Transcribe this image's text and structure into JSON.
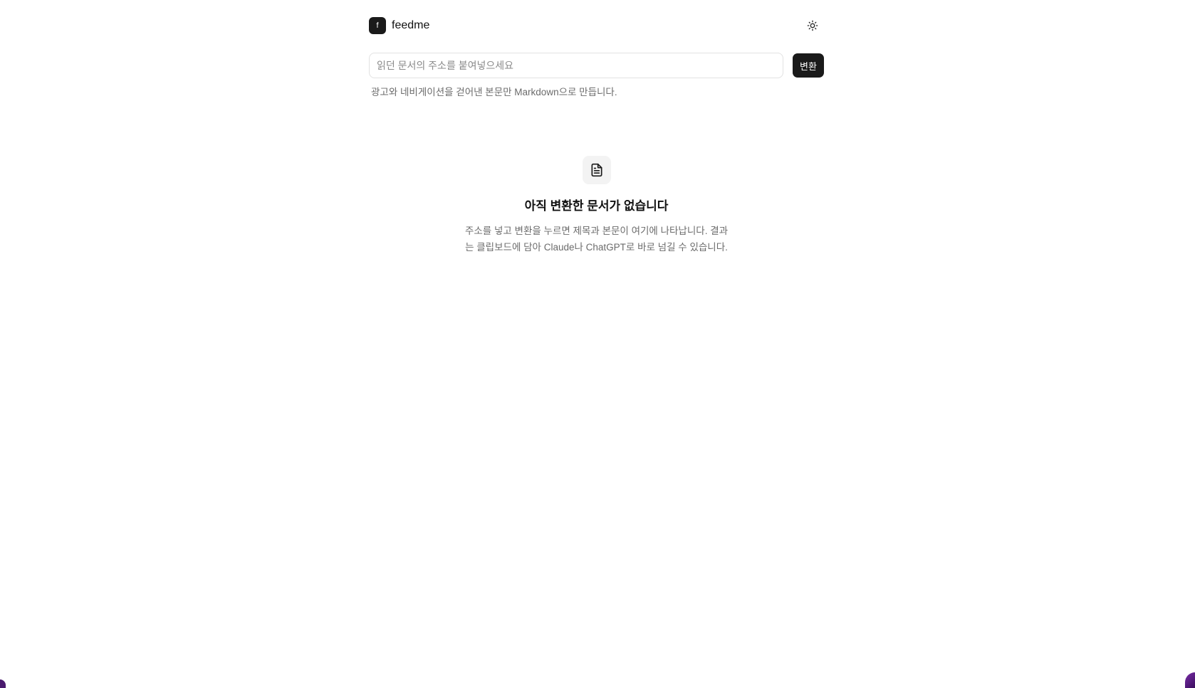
{
  "header": {
    "logo_letter": "f",
    "app_name": "feedme"
  },
  "url_form": {
    "placeholder": "읽던 문서의 주소를 붙여넣으세요",
    "value": "",
    "convert_label": "변환",
    "helper": "광고와 네비게이션을 걷어낸 본문만 Markdown으로 만듭니다."
  },
  "empty_state": {
    "icon": "document-icon",
    "title": "아직 변환한 문서가 없습니다",
    "description": "주소를 넣고 변환을 누르면 제목과 본문이 여기에 나타납니다. 결과는 클립보드에 담아 Claude나 ChatGPT로 바로 넘길 수 있습니다."
  },
  "icons": {
    "theme_toggle": "sun-icon"
  },
  "colors": {
    "accent": "#1a1a1a",
    "muted_text": "#6b6b6b",
    "border": "#e2e2e2",
    "icon_bg": "#f3f3f3"
  }
}
